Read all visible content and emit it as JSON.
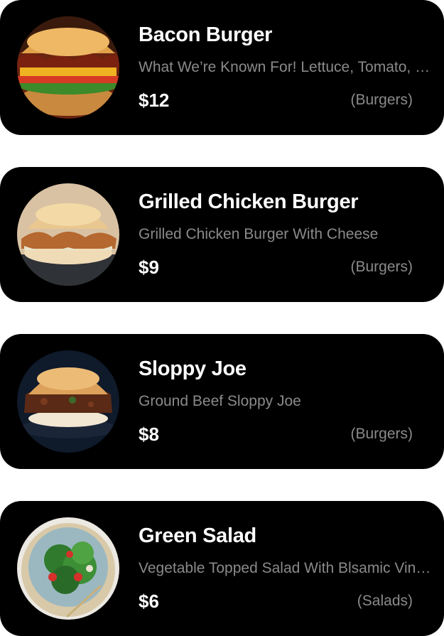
{
  "items": [
    {
      "name": "Bacon Burger",
      "description": "What We’re Known For! Lettuce, Tomato, Onion",
      "price": "$12",
      "category": "(Burgers)",
      "image_icon": "bacon-burger-image"
    },
    {
      "name": "Grilled Chicken Burger",
      "description": "Grilled Chicken Burger With Cheese",
      "price": "$9",
      "category": "(Burgers)",
      "image_icon": "chicken-burger-image"
    },
    {
      "name": "Sloppy Joe",
      "description": "Ground Beef Sloppy Joe",
      "price": "$8",
      "category": "(Burgers)",
      "image_icon": "sloppy-joe-image"
    },
    {
      "name": "Green Salad",
      "description": "Vegetable Topped Salad With Blsamic Vinaigrette",
      "price": "$6",
      "category": "(Salads)",
      "image_icon": "green-salad-image"
    }
  ],
  "colors": {
    "card_background": "#000000",
    "page_background": "#ffffff",
    "title_text": "#ffffff",
    "muted_text": "#8a8a8a"
  }
}
